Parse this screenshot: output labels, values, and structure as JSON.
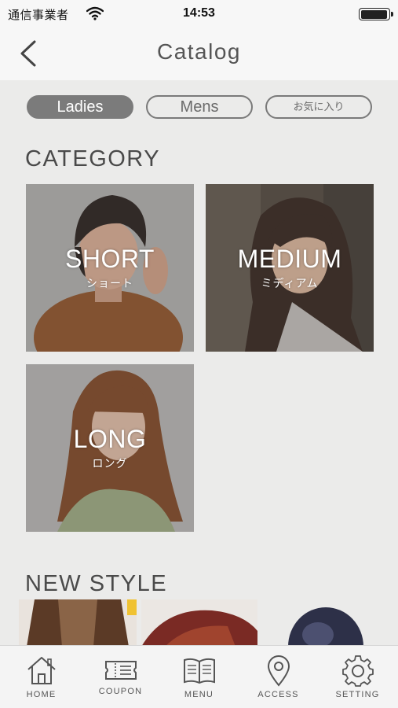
{
  "status": {
    "carrier": "通信事業者",
    "time": "14:53",
    "battery_level": 0.95
  },
  "nav": {
    "title": "Catalog"
  },
  "tabs_filter": [
    {
      "label": "Ladies",
      "active": true
    },
    {
      "label": "Mens",
      "active": false
    },
    {
      "label": "お気に入り",
      "active": false
    }
  ],
  "category": {
    "heading": "CATEGORY",
    "items": [
      {
        "en": "SHORT",
        "jp": "ショート"
      },
      {
        "en": "MEDIUM",
        "jp": "ミディアム"
      },
      {
        "en": "LONG",
        "jp": "ロング"
      }
    ]
  },
  "new_style": {
    "heading": "NEW STYLE"
  },
  "tab_bar": {
    "items": [
      {
        "label": "HOME",
        "icon": "home-icon"
      },
      {
        "label": "COUPON",
        "icon": "coupon-icon"
      },
      {
        "label": "MENU",
        "icon": "book-icon"
      },
      {
        "label": "ACCESS",
        "icon": "location-pin-icon"
      },
      {
        "label": "SETTING",
        "icon": "gear-icon"
      }
    ]
  },
  "colors": {
    "accent": "#7b7b7b",
    "background": "#ebebea",
    "bar": "#f7f7f7"
  }
}
